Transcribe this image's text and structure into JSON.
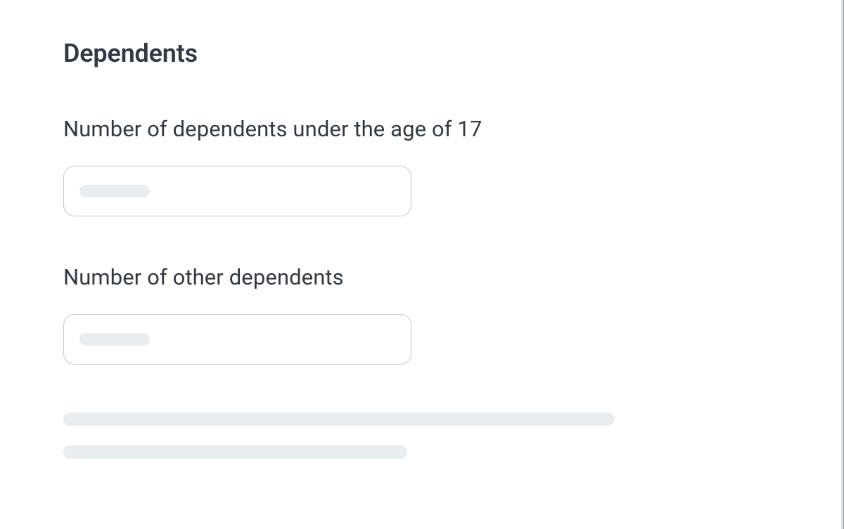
{
  "section": {
    "heading": "Dependents",
    "fields": [
      {
        "label": "Number of dependents under the age of 17",
        "value": ""
      },
      {
        "label": "Number of other dependents",
        "value": ""
      }
    ]
  }
}
